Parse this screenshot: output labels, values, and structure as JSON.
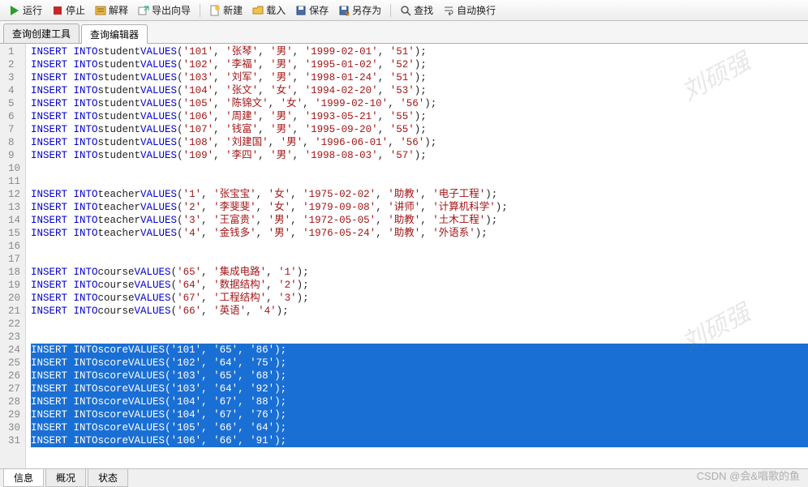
{
  "toolbar": {
    "run": "运行",
    "stop": "停止",
    "explain": "解释",
    "export_wizard": "导出向导",
    "new": "新建",
    "load": "载入",
    "save": "保存",
    "save_as": "另存为",
    "find": "查找",
    "wrap": "自动换行"
  },
  "tabs": {
    "builder": "查询创建工具",
    "editor": "查询编辑器"
  },
  "bottom_tabs": {
    "info": "信息",
    "overview": "概况",
    "status": "状态"
  },
  "watermark": "刘硕强",
  "csdn": "CSDN @会&唱歌的鱼",
  "lines": [
    {
      "n": 1,
      "kw": "INSERT INTO",
      "tbl": "student",
      "fn": "VALUES",
      "args": [
        "'101'",
        "'张琴'",
        "'男'",
        "'1999-02-01'",
        "'51'"
      ],
      "sel": false
    },
    {
      "n": 2,
      "kw": "INSERT INTO",
      "tbl": "student",
      "fn": "VALUES",
      "args": [
        "'102'",
        "'李福'",
        "'男'",
        "'1995-01-02'",
        "'52'"
      ],
      "sel": false
    },
    {
      "n": 3,
      "kw": "INSERT INTO",
      "tbl": "student",
      "fn": "VALUES",
      "args": [
        "'103'",
        "'刘军'",
        "'男'",
        "'1998-01-24'",
        "'51'"
      ],
      "sel": false
    },
    {
      "n": 4,
      "kw": "INSERT INTO",
      "tbl": "student",
      "fn": "VALUES",
      "args": [
        "'104'",
        "'张文'",
        "'女'",
        "'1994-02-20'",
        "'53'"
      ],
      "sel": false
    },
    {
      "n": 5,
      "kw": "INSERT INTO",
      "tbl": "student",
      "fn": "VALUES",
      "args": [
        "'105'",
        "'陈锦文'",
        "'女'",
        "'1999-02-10'",
        "'56'"
      ],
      "sel": false
    },
    {
      "n": 6,
      "kw": "INSERT INTO",
      "tbl": "student",
      "fn": "VALUES",
      "args": [
        "'106'",
        "'周建'",
        "'男'",
        "'1993-05-21'",
        "'55'"
      ],
      "sel": false
    },
    {
      "n": 7,
      "kw": "INSERT INTO",
      "tbl": "student",
      "fn": "VALUES",
      "args": [
        "'107'",
        "'钱富'",
        "'男'",
        "'1995-09-20'",
        "'55'"
      ],
      "sel": false
    },
    {
      "n": 8,
      "kw": "INSERT INTO",
      "tbl": "student",
      "fn": "VALUES",
      "args": [
        "'108'",
        "'刘建国'",
        "'男'",
        "'1996-06-01'",
        "'56'"
      ],
      "sel": false
    },
    {
      "n": 9,
      "kw": "INSERT INTO",
      "tbl": "student",
      "fn": "VALUES",
      "args": [
        "'109'",
        "'李四'",
        "'男'",
        "'1998-08-03'",
        "'57'"
      ],
      "sel": false
    },
    {
      "n": 10,
      "blank": true
    },
    {
      "n": 11,
      "blank": true
    },
    {
      "n": 12,
      "kw": "INSERT INTO",
      "tbl": "teacher",
      "fn": "VALUES",
      "args": [
        "'1'",
        "'张宝宝'",
        "'女'",
        "'1975-02-02'",
        "'助教'",
        "'电子工程'"
      ],
      "sel": false
    },
    {
      "n": 13,
      "kw": "INSERT INTO",
      "tbl": "teacher",
      "fn": "VALUES",
      "args": [
        "'2'",
        "'李斐斐'",
        "'女'",
        "'1979-09-08'",
        "'讲师'",
        "'计算机科学'"
      ],
      "sel": false
    },
    {
      "n": 14,
      "kw": "INSERT INTO",
      "tbl": "teacher",
      "fn": "VALUES",
      "args": [
        "'3'",
        "'王富贵'",
        "'男'",
        "'1972-05-05'",
        "'助教'",
        "'土木工程'"
      ],
      "sel": false
    },
    {
      "n": 15,
      "kw": "INSERT INTO",
      "tbl": "teacher",
      "fn": "VALUES",
      "args": [
        "'4'",
        "'金钱多'",
        "'男'",
        "'1976-05-24'",
        "'助教'",
        "'外语系'"
      ],
      "sel": false
    },
    {
      "n": 16,
      "blank": true
    },
    {
      "n": 17,
      "blank": true
    },
    {
      "n": 18,
      "kw": "INSERT INTO",
      "tbl": "course",
      "fn": "VALUES",
      "args": [
        "'65'",
        "'集成电路'",
        "'1'"
      ],
      "sel": false
    },
    {
      "n": 19,
      "kw": "INSERT INTO",
      "tbl": "course",
      "fn": "VALUES",
      "args": [
        "'64'",
        "'数据结构'",
        "'2'"
      ],
      "sel": false
    },
    {
      "n": 20,
      "kw": "INSERT INTO",
      "tbl": "course",
      "fn": "VALUES",
      "args": [
        "'67'",
        "'工程结构'",
        "'3'"
      ],
      "sel": false
    },
    {
      "n": 21,
      "kw": "INSERT INTO",
      "tbl": "course",
      "fn": "VALUES",
      "args": [
        "'66'",
        "'英语'",
        "'4'"
      ],
      "sel": false
    },
    {
      "n": 22,
      "blank": true
    },
    {
      "n": 23,
      "blank": true
    },
    {
      "n": 24,
      "kw": "INSERT INTO",
      "tbl": "score",
      "fn": "VALUES",
      "args": [
        "'101'",
        "'65'",
        "'86'"
      ],
      "sel": true
    },
    {
      "n": 25,
      "kw": "INSERT INTO",
      "tbl": "score",
      "fn": "VALUES",
      "args": [
        "'102'",
        "'64'",
        "'75'"
      ],
      "sel": true
    },
    {
      "n": 26,
      "kw": "INSERT INTO",
      "tbl": "score",
      "fn": "VALUES",
      "args": [
        "'103'",
        "'65'",
        "'68'"
      ],
      "sel": true
    },
    {
      "n": 27,
      "kw": "INSERT INTO",
      "tbl": "score",
      "fn": "VALUES",
      "args": [
        "'103'",
        "'64'",
        "'92'"
      ],
      "sel": true
    },
    {
      "n": 28,
      "kw": "INSERT INTO",
      "tbl": "score",
      "fn": "VALUES",
      "args": [
        "'104'",
        "'67'",
        "'88'"
      ],
      "sel": true
    },
    {
      "n": 29,
      "kw": "INSERT INTO",
      "tbl": "score",
      "fn": "VALUES",
      "args": [
        "'104'",
        "'67'",
        "'76'"
      ],
      "sel": true
    },
    {
      "n": 30,
      "kw": "INSERT INTO",
      "tbl": "score",
      "fn": "VALUES",
      "args": [
        "'105'",
        "'66'",
        "'64'"
      ],
      "sel": true
    },
    {
      "n": 31,
      "kw": "INSERT INTO",
      "tbl": "score",
      "fn": "VALUES",
      "args": [
        "'106'",
        "'66'",
        "'91'"
      ],
      "sel": true
    }
  ]
}
